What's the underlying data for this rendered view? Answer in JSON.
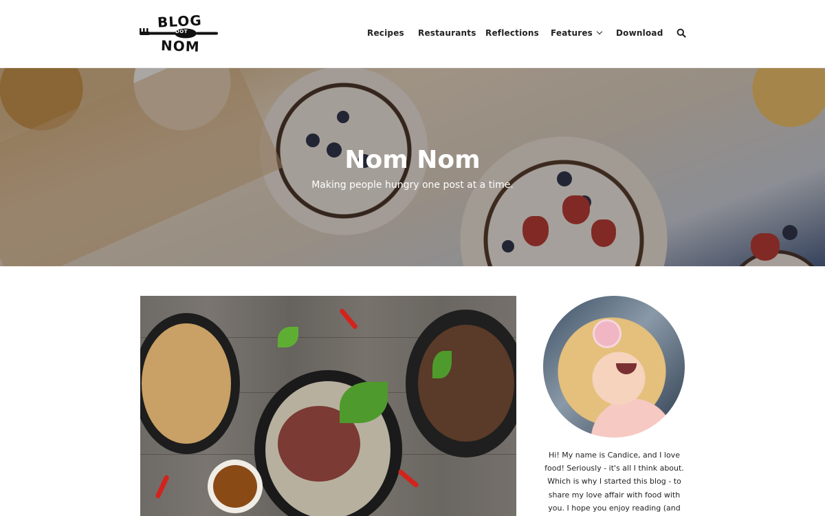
{
  "site": {
    "logo": {
      "line1": "BLOG",
      "line2": "NOM",
      "middle": "DOT"
    }
  },
  "nav": {
    "items": [
      {
        "label": "Recipes"
      },
      {
        "label": "Restaurants"
      },
      {
        "label": "Reflections"
      },
      {
        "label": "Features",
        "has_dropdown": true,
        "icon": "chevron-down-icon"
      },
      {
        "label": "Download"
      }
    ],
    "search_icon": "search-icon"
  },
  "hero": {
    "title": "Nom Nom",
    "subtitle": "Making people hungry one post at a time."
  },
  "sidebar": {
    "bio": "Hi! My name is Candice, and I love food! Seriously - it's all I think about. Which is why I started this blog - to share my love affair with food with you. I hope you enjoy reading (and eating) along with"
  },
  "colors": {
    "text": "#222222",
    "header_bg": "#ffffff",
    "hero_text": "#ffffff"
  }
}
